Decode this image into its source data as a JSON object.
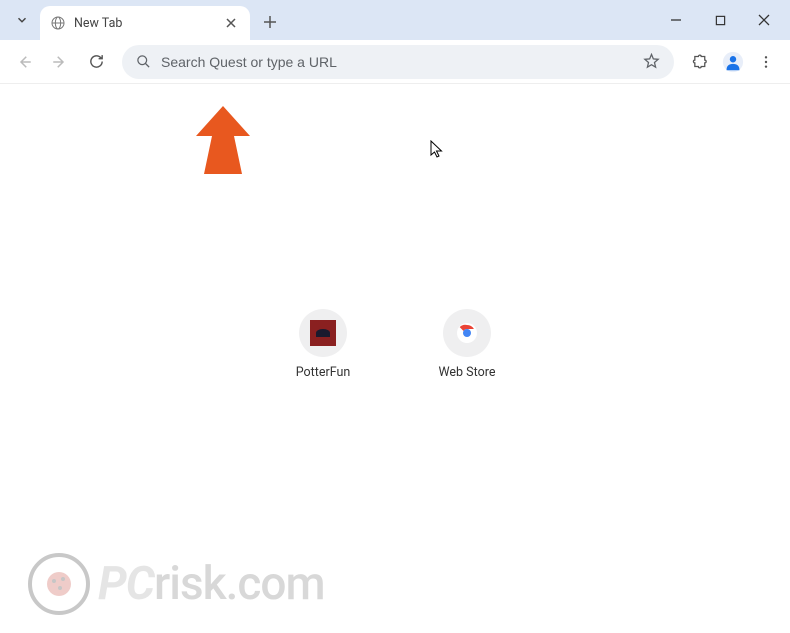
{
  "window": {
    "tab_title": "New Tab"
  },
  "omnibox": {
    "placeholder": "Search Quest or type a URL",
    "value": ""
  },
  "shortcuts": [
    {
      "label": "PotterFun"
    },
    {
      "label": "Web Store"
    }
  ],
  "watermark": {
    "text_pc": "PC",
    "text_risk": "risk.com"
  }
}
